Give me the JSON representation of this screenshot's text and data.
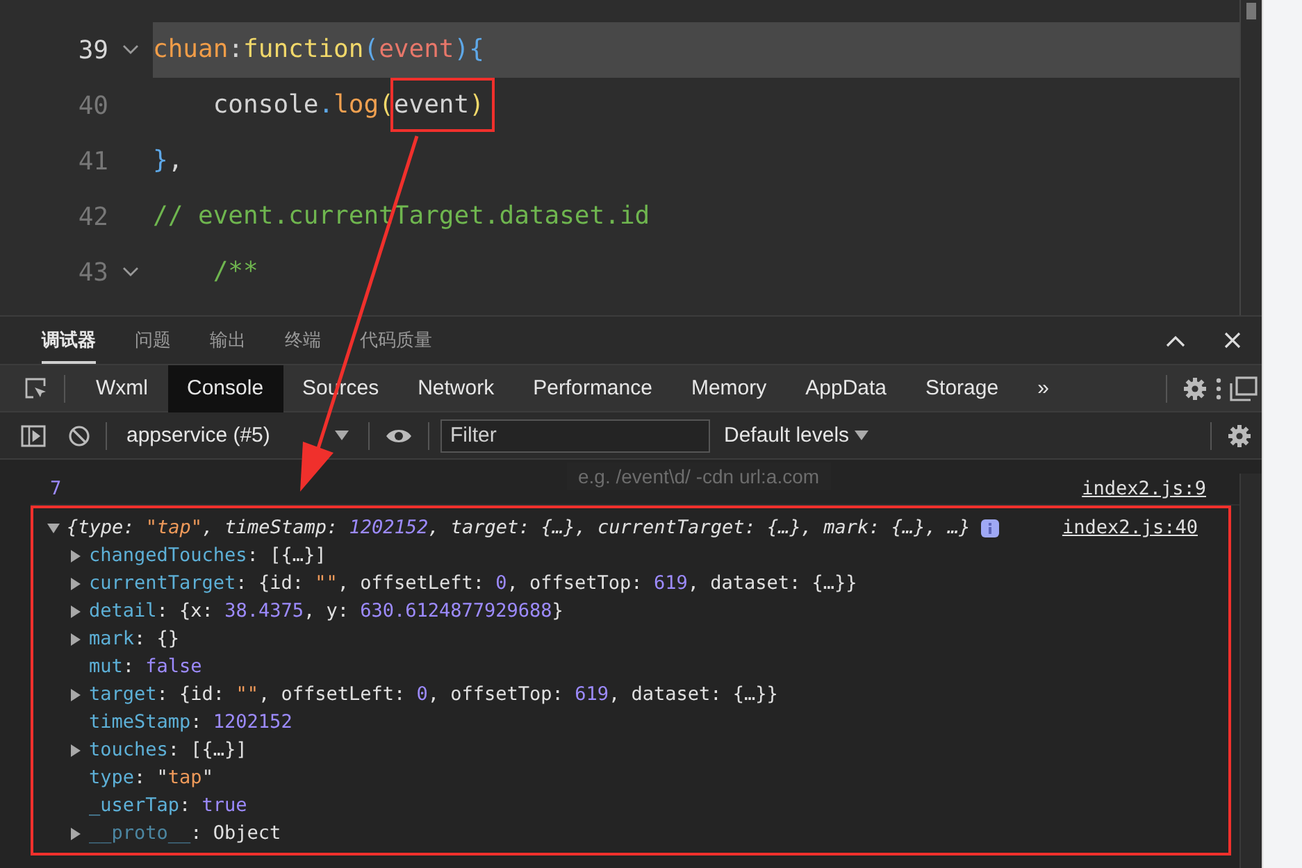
{
  "editor": {
    "lines": [
      {
        "number": "39",
        "fold": true,
        "current": true,
        "tokens": [
          {
            "kind": "key",
            "text": "chuan"
          },
          {
            "kind": "punct",
            "text": ":"
          },
          {
            "kind": "keyword",
            "text": "function"
          },
          {
            "kind": "bracket",
            "text": "("
          },
          {
            "kind": "param",
            "text": "event"
          },
          {
            "kind": "bracket",
            "text": ")"
          },
          {
            "kind": "bracket",
            "text": "{"
          }
        ]
      },
      {
        "number": "40",
        "fold": false,
        "current": false,
        "tokens": [
          {
            "kind": "plain",
            "text": "    console"
          },
          {
            "kind": "bracket",
            "text": "."
          },
          {
            "kind": "method",
            "text": "log"
          },
          {
            "kind": "paren",
            "text": "("
          },
          {
            "kind": "plain",
            "text": "event",
            "annotated": true
          },
          {
            "kind": "paren",
            "text": ")",
            "annotated": true
          }
        ]
      },
      {
        "number": "41",
        "fold": false,
        "current": false,
        "tokens": [
          {
            "kind": "bracket",
            "text": "}"
          },
          {
            "kind": "punct",
            "text": ","
          }
        ]
      },
      {
        "number": "42",
        "fold": false,
        "current": false,
        "tokens": [
          {
            "kind": "comment",
            "text": "// event.currentTarget.dataset.id"
          }
        ]
      },
      {
        "number": "43",
        "fold": true,
        "current": false,
        "tokens": [
          {
            "kind": "comment",
            "text": "    /**"
          }
        ]
      }
    ]
  },
  "panel_tabs": [
    {
      "label": "调试器",
      "selected": true
    },
    {
      "label": "问题",
      "selected": false
    },
    {
      "label": "输出",
      "selected": false
    },
    {
      "label": "终端",
      "selected": false
    },
    {
      "label": "代码质量",
      "selected": false
    }
  ],
  "tool_tabs": [
    {
      "label": "Wxml",
      "selected": false
    },
    {
      "label": "Console",
      "selected": true
    },
    {
      "label": "Sources",
      "selected": false
    },
    {
      "label": "Network",
      "selected": false
    },
    {
      "label": "Performance",
      "selected": false
    },
    {
      "label": "Memory",
      "selected": false
    },
    {
      "label": "AppData",
      "selected": false
    },
    {
      "label": "Storage",
      "selected": false
    }
  ],
  "more_tabs": "»",
  "toolbar": {
    "context": "appservice (#5)",
    "filter": {
      "placeholder": "Filter"
    },
    "levels": "Default levels",
    "filter_hint": "e.g. /event\\d/ -cdn url:a.com"
  },
  "console": {
    "messages": [
      {
        "kind": "value",
        "tokens": [
          {
            "kind": "num",
            "text": "7"
          }
        ],
        "source": "index2.js:9"
      },
      {
        "kind": "object",
        "expanded": true,
        "annotated": true,
        "summary": [
          {
            "kind": "punct",
            "text": "{type: "
          },
          {
            "kind": "str",
            "text": "\"tap\""
          },
          {
            "kind": "punct",
            "text": ", timeStamp: "
          },
          {
            "kind": "num",
            "text": "1202152"
          },
          {
            "kind": "punct",
            "text": ", target: {…}, currentTarget: {…}, mark: {…}, …}"
          }
        ],
        "source": "index2.js:40",
        "properties": [
          {
            "kind": "node",
            "expanded": false,
            "name": "changedTouches",
            "tokens": [
              {
                "kind": "punct",
                "text": ": "
              },
              {
                "kind": "punct",
                "text": "[{…}]"
              }
            ]
          },
          {
            "kind": "node",
            "expanded": false,
            "name": "currentTarget",
            "tokens": [
              {
                "kind": "punct",
                "text": ": "
              },
              {
                "kind": "punct",
                "text": "{id: "
              },
              {
                "kind": "str",
                "text": "\"\""
              },
              {
                "kind": "punct",
                "text": ", offsetLeft: "
              },
              {
                "kind": "num",
                "text": "0"
              },
              {
                "kind": "punct",
                "text": ", offsetTop: "
              },
              {
                "kind": "num",
                "text": "619"
              },
              {
                "kind": "punct",
                "text": ", dataset: {…}}"
              }
            ]
          },
          {
            "kind": "node",
            "expanded": false,
            "name": "detail",
            "tokens": [
              {
                "kind": "punct",
                "text": ": "
              },
              {
                "kind": "punct",
                "text": "{x: "
              },
              {
                "kind": "num",
                "text": "38.4375"
              },
              {
                "kind": "punct",
                "text": ", y: "
              },
              {
                "kind": "num",
                "text": "630.6124877929688"
              },
              {
                "kind": "punct",
                "text": "}"
              }
            ]
          },
          {
            "kind": "node",
            "expanded": false,
            "name": "mark",
            "tokens": [
              {
                "kind": "punct",
                "text": ": "
              },
              {
                "kind": "punct",
                "text": "{}"
              }
            ]
          },
          {
            "kind": "leaf",
            "name": "mut",
            "tokens": [
              {
                "kind": "punct",
                "text": ": "
              },
              {
                "kind": "num",
                "text": "false"
              }
            ]
          },
          {
            "kind": "node",
            "expanded": false,
            "name": "target",
            "tokens": [
              {
                "kind": "punct",
                "text": ": "
              },
              {
                "kind": "punct",
                "text": "{id: "
              },
              {
                "kind": "str",
                "text": "\"\""
              },
              {
                "kind": "punct",
                "text": ", offsetLeft: "
              },
              {
                "kind": "num",
                "text": "0"
              },
              {
                "kind": "punct",
                "text": ", offsetTop: "
              },
              {
                "kind": "num",
                "text": "619"
              },
              {
                "kind": "punct",
                "text": ", dataset: {…}}"
              }
            ]
          },
          {
            "kind": "leaf",
            "name": "timeStamp",
            "tokens": [
              {
                "kind": "punct",
                "text": ": "
              },
              {
                "kind": "num",
                "text": "1202152"
              }
            ]
          },
          {
            "kind": "node",
            "expanded": false,
            "name": "touches",
            "tokens": [
              {
                "kind": "punct",
                "text": ": "
              },
              {
                "kind": "punct",
                "text": "[{…}]"
              }
            ]
          },
          {
            "kind": "leaf",
            "name": "type",
            "tokens": [
              {
                "kind": "punct",
                "text": ": "
              },
              {
                "kind": "punct",
                "text": "\""
              },
              {
                "kind": "str",
                "text": "tap"
              },
              {
                "kind": "punct",
                "text": "\""
              }
            ]
          },
          {
            "kind": "leaf",
            "name": "_userTap",
            "tokens": [
              {
                "kind": "punct",
                "text": ": "
              },
              {
                "kind": "num",
                "text": "true"
              }
            ]
          },
          {
            "kind": "proto",
            "expanded": false,
            "name": "__proto__",
            "tokens": [
              {
                "kind": "punct",
                "text": ": "
              },
              {
                "kind": "punct",
                "text": "Object"
              }
            ]
          }
        ]
      }
    ]
  }
}
